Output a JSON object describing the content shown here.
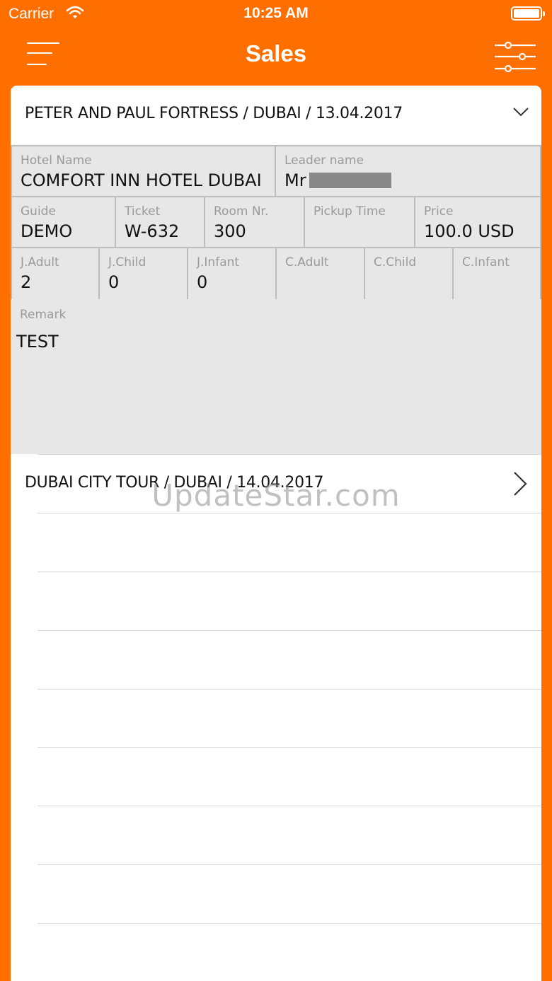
{
  "status_bar": {
    "carrier": "Carrier",
    "time": "10:25 AM"
  },
  "nav": {
    "title": "Sales",
    "left_icon": "menu-icon",
    "right_icon": "filter-sliders-icon"
  },
  "colors": {
    "brand": "#FF6F00",
    "cell_bg": "#E7E7E7",
    "cell_border": "#BDBDBD",
    "label": "#9A9A9A"
  },
  "expanded_tour": {
    "title": "PETER AND PAUL FORTRESS / DUBAI / 13.04.2017",
    "hotel_label": "Hotel Name",
    "hotel_value": "COMFORT INN HOTEL DUBAI",
    "leader_label": "Leader name",
    "leader_value": "Mr",
    "guide_label": "Guide",
    "guide_value": "DEMO",
    "ticket_label": "Ticket",
    "ticket_value": "W-632",
    "room_label": "Room Nr.",
    "room_value": "300",
    "pickup_label": "Pickup Time",
    "pickup_value": "",
    "price_label": "Price",
    "price_value": "100.0 USD",
    "j_adult_label": "J.Adult",
    "j_adult_value": "2",
    "j_child_label": "J.Child",
    "j_child_value": "0",
    "j_infant_label": "J.Infant",
    "j_infant_value": "0",
    "c_adult_label": "C.Adult",
    "c_adult_value": "",
    "c_child_label": "C.Child",
    "c_child_value": "",
    "c_infant_label": "C.Infant",
    "c_infant_value": "",
    "remark_label": "Remark",
    "remark_value": "TEST"
  },
  "tours": [
    {
      "title": "DUBAI CITY TOUR  / DUBAI / 14.04.2017"
    }
  ],
  "watermark": "UpdateStar.com"
}
